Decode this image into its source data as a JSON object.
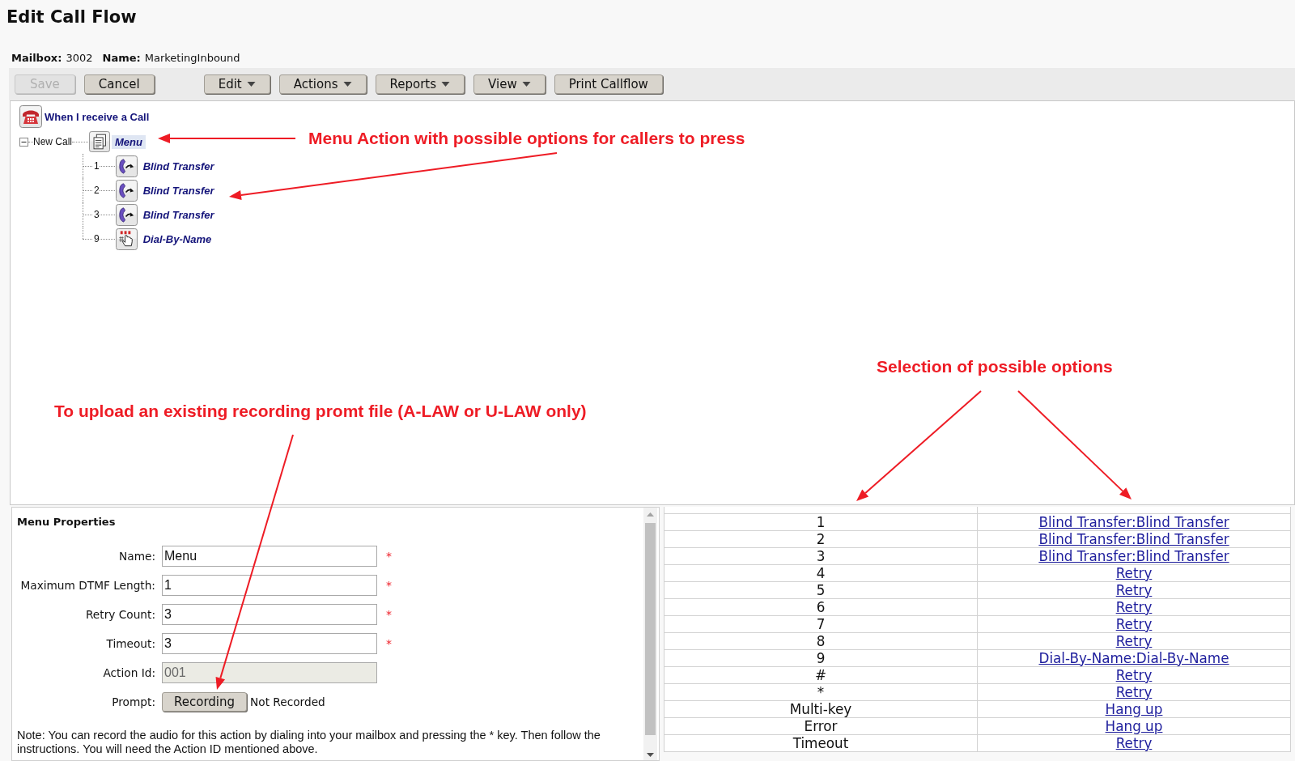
{
  "page": {
    "title": "Edit Call Flow"
  },
  "mailbox_info": [
    {
      "label": "Mailbox:",
      "value": "3002"
    },
    {
      "label": "Name:",
      "value": "MarketingInbound"
    }
  ],
  "toolbar": [
    {
      "buttons": [
        {
          "label": "Save",
          "disabled": true,
          "dropdown": false
        },
        {
          "label": "Cancel",
          "disabled": false,
          "dropdown": false
        }
      ]
    },
    {
      "buttons": [
        {
          "label": "Edit",
          "disabled": false,
          "dropdown": true
        },
        {
          "label": "Actions",
          "disabled": false,
          "dropdown": true
        },
        {
          "label": "Reports",
          "disabled": false,
          "dropdown": true
        },
        {
          "label": "View",
          "disabled": false,
          "dropdown": true
        },
        {
          "label": "Print Callflow",
          "disabled": false,
          "dropdown": false
        }
      ]
    }
  ],
  "call_flow": {
    "trigger": {
      "kind": "incoming_call",
      "label": "When I receive a Call"
    },
    "branches": [
      {
        "label": "New Call",
        "expanded": true,
        "action": {
          "kind": "menu",
          "label": "Menu",
          "selected": true
        },
        "children": [
          {
            "label": "1",
            "action": {
              "kind": "blind_transfer",
              "label": "Blind Transfer",
              "selected": false
            }
          },
          {
            "label": "2",
            "action": {
              "kind": "blind_transfer",
              "label": "Blind Transfer",
              "selected": false
            }
          },
          {
            "label": "3",
            "action": {
              "kind": "blind_transfer",
              "label": "Blind Transfer",
              "selected": false
            }
          },
          {
            "label": "9",
            "action": {
              "kind": "dial_by_name",
              "label": "Dial-By-Name",
              "selected": false
            }
          }
        ]
      }
    ]
  },
  "menu_properties": {
    "title": "Menu Properties",
    "fields": [
      {
        "kind": "text",
        "label": "Name:",
        "value": "Menu",
        "disabled": false,
        "marker": "*"
      },
      {
        "kind": "text",
        "label": "Maximum DTMF Length:",
        "value": "1",
        "disabled": false,
        "marker": "*"
      },
      {
        "kind": "text",
        "label": "Retry Count:",
        "value": "3",
        "disabled": false,
        "marker": "*"
      },
      {
        "kind": "text",
        "label": "Timeout:",
        "value": "3",
        "disabled": false,
        "marker": "*"
      },
      {
        "kind": "text",
        "label": "Action Id:",
        "value": "001",
        "disabled": true
      },
      {
        "kind": "prompt",
        "label": "Prompt:",
        "button": "Recording",
        "status": "Not Recorded"
      }
    ],
    "note": "Note: You can record the audio for this action by dialing into your mailbox and pressing the * key. Then follow the instructions. You will need the Action ID mentioned above."
  },
  "menu_options": {
    "rows": [
      {
        "key": "1",
        "action": "Blind Transfer:Blind Transfer"
      },
      {
        "key": "2",
        "action": "Blind Transfer:Blind Transfer"
      },
      {
        "key": "3",
        "action": "Blind Transfer:Blind Transfer"
      },
      {
        "key": "4",
        "action": "Retry"
      },
      {
        "key": "5",
        "action": "Retry"
      },
      {
        "key": "6",
        "action": "Retry"
      },
      {
        "key": "7",
        "action": "Retry"
      },
      {
        "key": "8",
        "action": "Retry"
      },
      {
        "key": "9",
        "action": "Dial-By-Name:Dial-By-Name"
      },
      {
        "key": "#",
        "action": "Retry"
      },
      {
        "key": "*",
        "action": "Retry"
      },
      {
        "key": "Multi-key",
        "action": "Hang up"
      },
      {
        "key": "Error",
        "action": "Hang up"
      },
      {
        "key": "Timeout",
        "action": "Retry"
      }
    ]
  },
  "annotations": [
    {
      "text": "Menu Action with possible options for callers to press"
    },
    {
      "text": "Selection of possible options"
    },
    {
      "text": "To upload an existing recording promt file (A-LAW or U-LAW only)"
    }
  ]
}
